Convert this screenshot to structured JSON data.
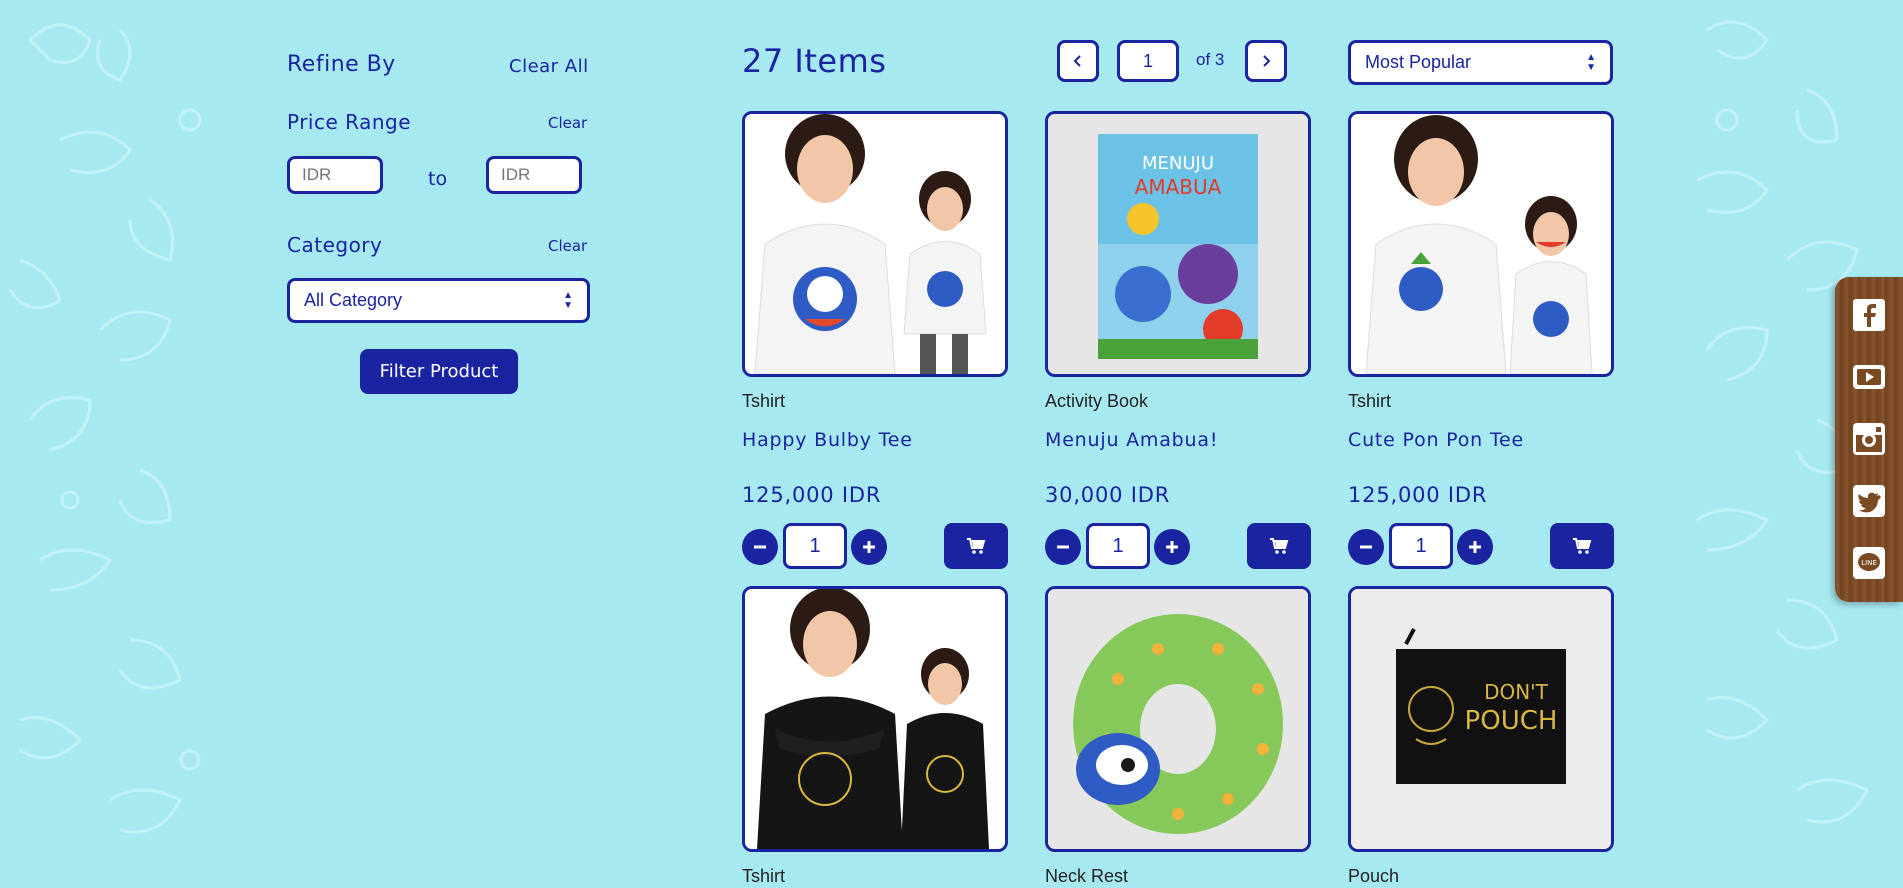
{
  "colors": {
    "background": "#a6e9f1",
    "primary": "#1a23a0",
    "wood": "#7a4a23"
  },
  "sidebar": {
    "refine_title": "Refine By",
    "clear_all": "Clear All",
    "price_title": "Price Range",
    "price_clear": "Clear",
    "price_min_placeholder": "IDR",
    "price_to": "to",
    "price_max_placeholder": "IDR",
    "category_title": "Category",
    "category_clear": "Clear",
    "category_selected": "All Category",
    "filter_button": "Filter Product"
  },
  "header": {
    "items_count": "27 Items",
    "page_current": "1",
    "page_of": "of 3",
    "sort_selected": "Most Popular"
  },
  "products": [
    {
      "category": "Tshirt",
      "name": "Happy Bulby Tee",
      "price": "125,000 IDR",
      "qty": "1",
      "image": "white-tshirt-photo"
    },
    {
      "category": "Activity Book",
      "name": "Menuju Amabua!",
      "price": "30,000 IDR",
      "qty": "1",
      "image": "activity-book-photo"
    },
    {
      "category": "Tshirt",
      "name": "Cute Pon Pon Tee",
      "price": "125,000 IDR",
      "qty": "1",
      "image": "white-tshirt-photo"
    },
    {
      "category": "Tshirt",
      "name": "",
      "price": "",
      "qty": "",
      "image": "black-tshirt-photo"
    },
    {
      "category": "Neck Rest",
      "name": "",
      "price": "",
      "qty": "",
      "image": "neck-pillow-photo"
    },
    {
      "category": "Pouch",
      "name": "",
      "price": "",
      "qty": "",
      "image": "pouch-photo"
    }
  ],
  "social": [
    "facebook-icon",
    "youtube-icon",
    "instagram-icon",
    "twitter-icon",
    "line-icon"
  ]
}
